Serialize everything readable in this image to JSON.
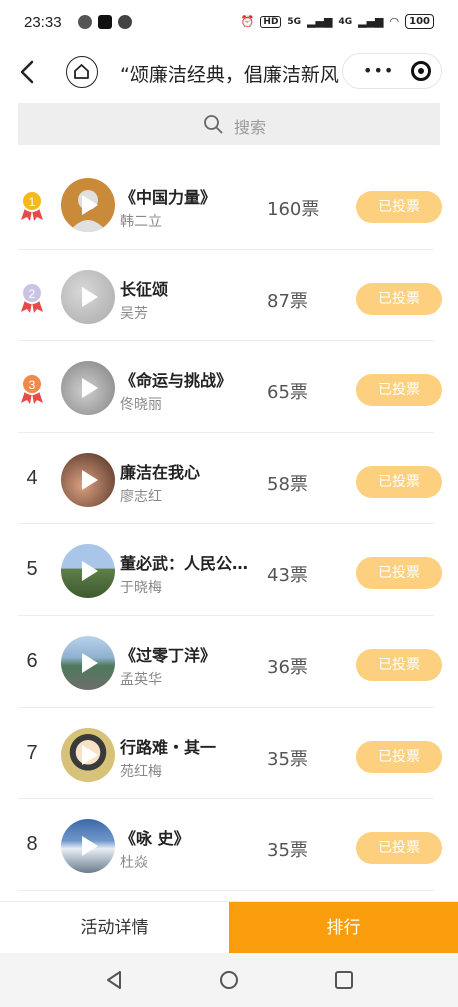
{
  "status_bar": {
    "time": "23:33",
    "right_badges": [
      "HD",
      "5G",
      "4G"
    ],
    "battery": "100"
  },
  "title_bar": {
    "title": "“颂廉洁经典，倡廉洁新风",
    "capsule_dots": "•••"
  },
  "search": {
    "placeholder": "搜索"
  },
  "entries": [
    {
      "rank": "1",
      "title": "《中国力量》",
      "author": "韩二立",
      "votes": "160票",
      "button": "已投票",
      "medal": "gold",
      "avatar": "#c98a3a"
    },
    {
      "rank": "2",
      "title": "长征颂",
      "author": "吴芳",
      "votes": "87票",
      "button": "已投票",
      "medal": "silver",
      "avatar": "#b9b9b9"
    },
    {
      "rank": "3",
      "title": "《命运与挑战》",
      "author": "佟晓丽",
      "votes": "65票",
      "button": "已投票",
      "medal": "bronze",
      "avatar": "#9a9a9a"
    },
    {
      "rank": "4",
      "title": "廉洁在我心",
      "author": "廖志红",
      "votes": "58票",
      "button": "已投票",
      "medal": "",
      "avatar": "#7a4a36"
    },
    {
      "rank": "5",
      "title": "董必武：人民公仆的楷模",
      "author": "于晓梅",
      "votes": "43票",
      "button": "已投票",
      "medal": "",
      "avatar": "#6f8a5a"
    },
    {
      "rank": "6",
      "title": "《过零丁洋》",
      "author": "孟英华",
      "votes": "36票",
      "button": "已投票",
      "medal": "",
      "avatar": "#5d7f6a"
    },
    {
      "rank": "7",
      "title": "行路难・其一",
      "author": "苑红梅",
      "votes": "35票",
      "button": "已投票",
      "medal": "",
      "avatar": "#d7c27a"
    },
    {
      "rank": "8",
      "title": "《咏 史》",
      "author": "杜焱",
      "votes": "35票",
      "button": "已投票",
      "medal": "",
      "avatar": "#4f6f97"
    }
  ],
  "bottom_tabs": {
    "detail": "活动详情",
    "rank": "排行"
  },
  "icons": {
    "back": "back-arrow-icon",
    "home": "home-icon",
    "search": "search-icon",
    "more": "more-dots-icon",
    "close": "close-circle-icon"
  }
}
